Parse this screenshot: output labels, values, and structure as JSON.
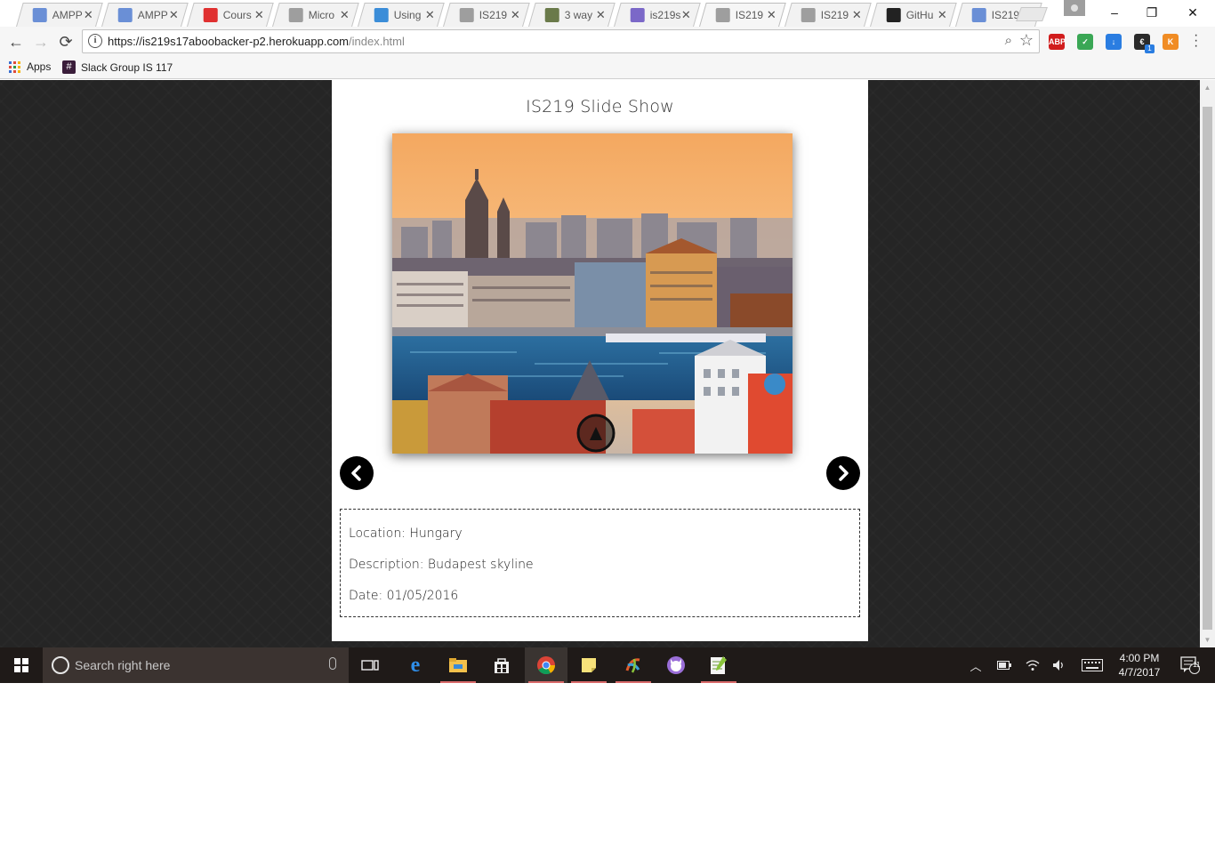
{
  "browser": {
    "tabs": [
      {
        "title": "AMPP",
        "favicon": "ampp-icon",
        "color": "#6a8fd6",
        "active": false
      },
      {
        "title": "AMPP",
        "favicon": "ampp-icon",
        "color": "#6a8fd6",
        "active": false
      },
      {
        "title": "Cours",
        "favicon": "course-icon",
        "color": "#e03030",
        "active": false
      },
      {
        "title": "Micro",
        "favicon": "page-icon",
        "color": "#9e9e9e",
        "active": false
      },
      {
        "title": "Using",
        "favicon": "using-icon",
        "color": "#3b8dd8",
        "active": false
      },
      {
        "title": "IS219",
        "favicon": "page-icon",
        "color": "#9e9e9e",
        "active": false
      },
      {
        "title": "3 way",
        "favicon": "photo-icon",
        "color": "#6a7a4a",
        "active": false
      },
      {
        "title": "is219s",
        "favicon": "heroku-icon",
        "color": "#7b68c8",
        "active": false
      },
      {
        "title": "IS219",
        "favicon": "page-icon",
        "color": "#9e9e9e",
        "active": true
      },
      {
        "title": "IS219",
        "favicon": "page-icon",
        "color": "#9e9e9e",
        "active": false
      },
      {
        "title": "GitHu",
        "favicon": "github-icon",
        "color": "#222222",
        "active": false
      },
      {
        "title": "IS219",
        "favicon": "ampp-icon",
        "color": "#6a8fd6",
        "active": false
      }
    ],
    "tab_close": "✕",
    "window_controls": {
      "minimize": "–",
      "maximize": "❐",
      "close": "✕"
    },
    "nav": {
      "back": "←",
      "forward": "→",
      "reload": "⟳"
    },
    "address": {
      "host": "https://is219s17aboobacker-p2.herokuapp.com",
      "path": "/index.html"
    },
    "extensions": [
      {
        "name": "adblock-icon",
        "label": "ABP",
        "color": "#d11c1c"
      },
      {
        "name": "shield-extension-icon",
        "label": "✓",
        "color": "#3aa755"
      },
      {
        "name": "download-extension-icon",
        "label": "↓",
        "color": "#2a7de1"
      },
      {
        "name": "ecosia-extension-icon",
        "label": "€",
        "color": "#2b2b2b"
      },
      {
        "name": "orange-extension-icon",
        "label": "K",
        "color": "#f08c24"
      }
    ],
    "extension_badge": "1",
    "bookmarks": [
      {
        "label": "Apps",
        "icon": "apps-grid-icon"
      },
      {
        "label": "Slack Group IS 117",
        "icon": "slack-icon"
      }
    ]
  },
  "page": {
    "title": "IS219 Slide Show",
    "prev_arrow": "previous-arrow-icon",
    "next_arrow": "next-arrow-icon",
    "details": {
      "location": "Location: Hungary",
      "description": "Description: Budapest skyline",
      "date": "Date: 01/05/2016"
    }
  },
  "taskbar": {
    "search_placeholder": "Search right here",
    "pinned": [
      {
        "name": "task-view-icon",
        "color": "#1f1a18",
        "running": false,
        "active": false
      },
      {
        "name": "edge-icon",
        "color": "#1f1a18",
        "running": false,
        "active": false
      },
      {
        "name": "file-explorer-icon",
        "color": "#1f1a18",
        "running": true,
        "active": false
      },
      {
        "name": "store-icon",
        "color": "#1f1a18",
        "running": false,
        "active": false
      },
      {
        "name": "chrome-icon",
        "color": "#3a3431",
        "running": true,
        "active": true
      },
      {
        "name": "sticky-notes-icon",
        "color": "#1f1a18",
        "running": true,
        "active": false
      },
      {
        "name": "ampps-icon",
        "color": "#1f1a18",
        "running": true,
        "active": false
      },
      {
        "name": "github-desktop-icon",
        "color": "#1f1a18",
        "running": false,
        "active": false
      },
      {
        "name": "notepad-plus-icon",
        "color": "#1f1a18",
        "running": true,
        "active": false
      }
    ],
    "clock": {
      "time": "4:00 PM",
      "date": "4/7/2017"
    },
    "notification_count": "11"
  }
}
